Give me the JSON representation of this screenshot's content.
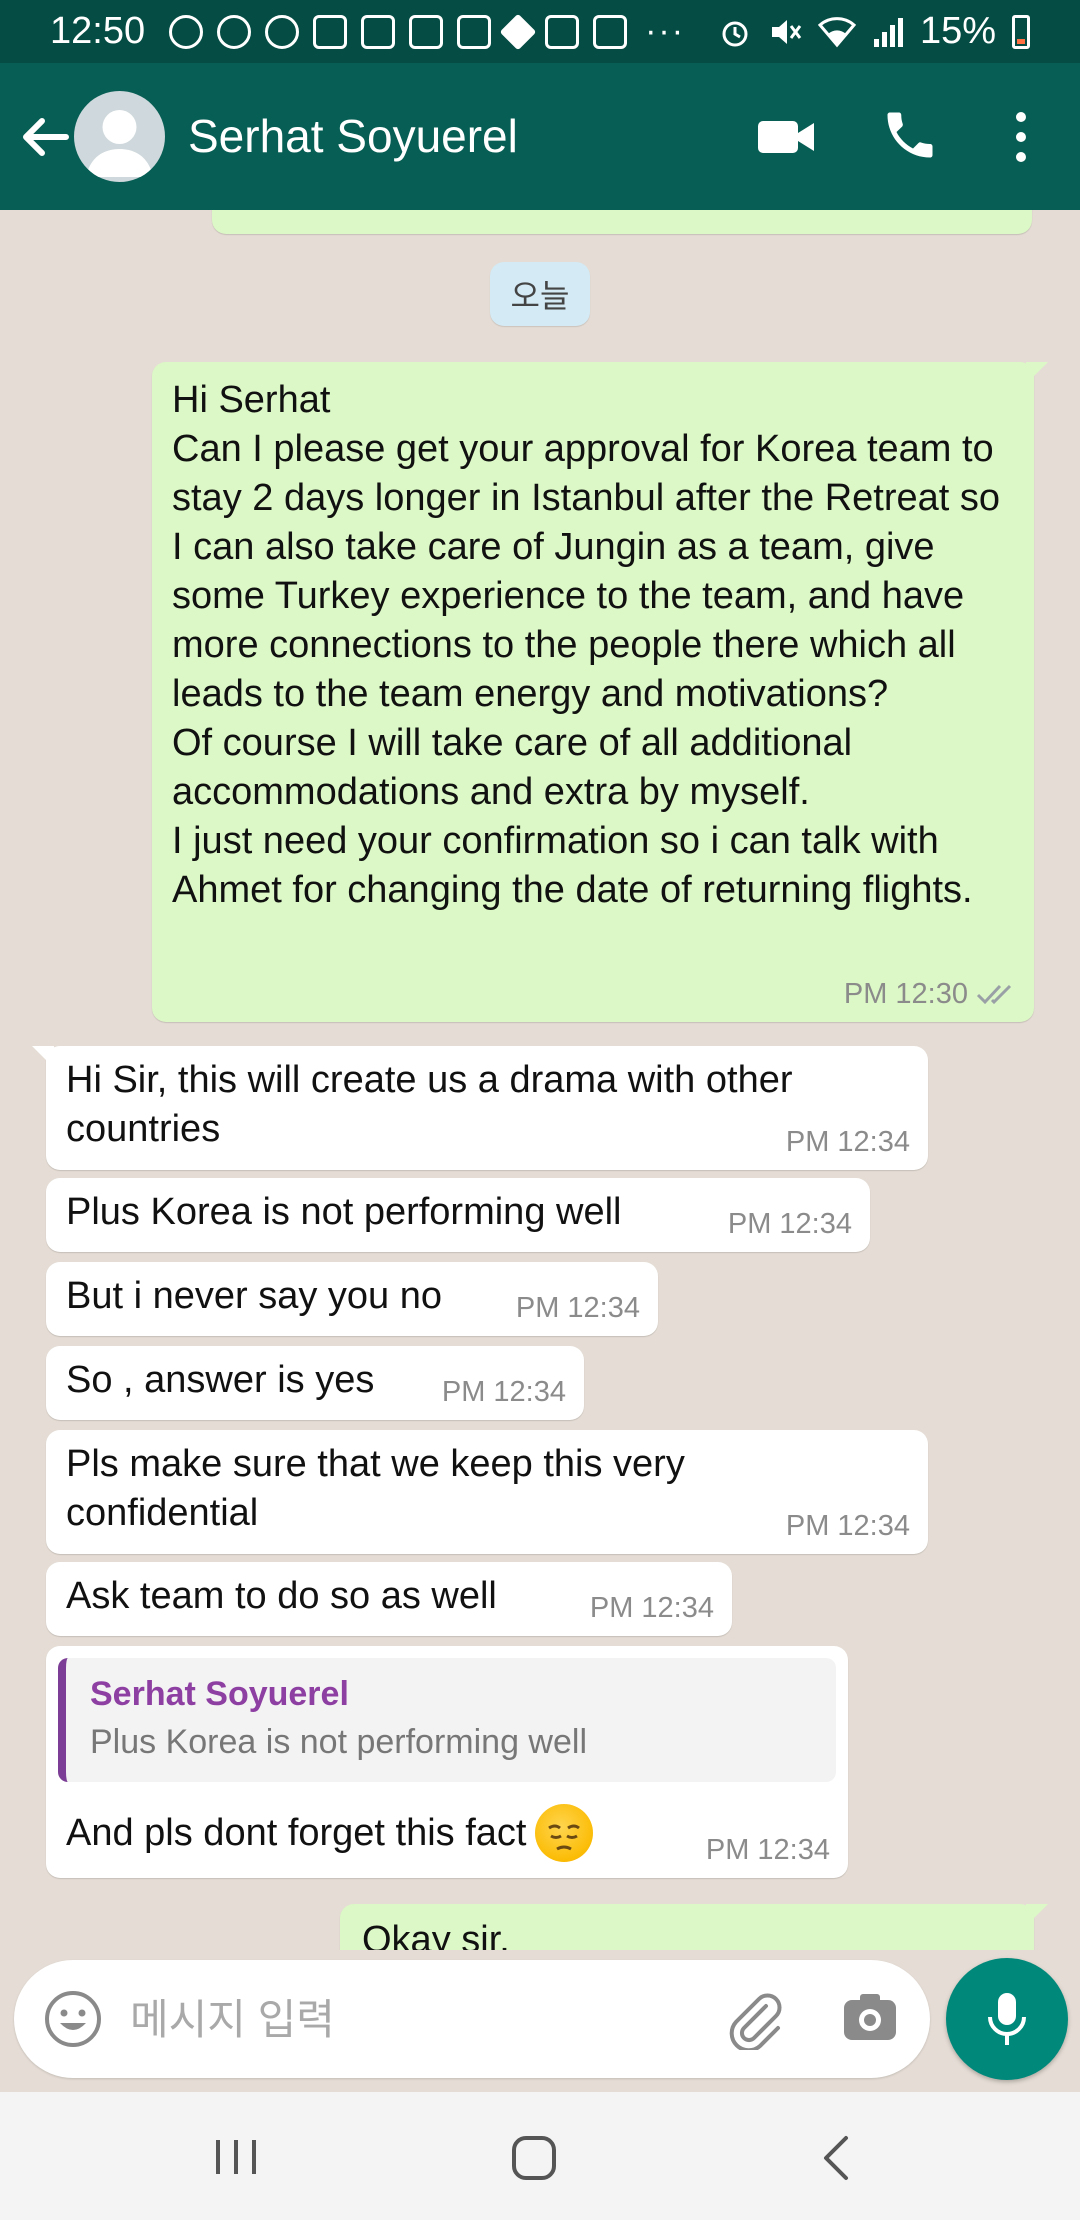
{
  "status_bar": {
    "time": "12:50",
    "overflow_dots": "···",
    "battery_percent": "15%",
    "notification_icons": [
      "circle-app-icon",
      "whatsapp-icon",
      "chat-at-icon",
      "gmail-icon",
      "gmail-icon",
      "jira-icon",
      "gmail-icon",
      "diamond-icon",
      "instagram-icon",
      "gmail-icon"
    ],
    "battery_level": 0.15
  },
  "header": {
    "contact_name": "Serhat Soyuerel",
    "colors": {
      "bar": "#075e54",
      "status": "#054d44"
    }
  },
  "chat": {
    "date_chip": "오늘",
    "messages": [
      {
        "direction": "out",
        "text": "Hi Serhat\nCan I please get your approval for Korea team to stay 2 days longer in Istanbul after the Retreat so I can also take care of Jungin as a team, give some Turkey experience to the team, and have more connections to the people there which all leads to the team energy and motivations?\nOf course I will take care of all additional accommodations and extra by myself.\nI just need your confirmation so i can talk with Ahmet for changing the date of returning flights.",
        "time": "PM 12:30",
        "read": true
      },
      {
        "direction": "in",
        "text": "Hi Sir, this will create us a drama with other countries",
        "time": "PM 12:34"
      },
      {
        "direction": "in",
        "text": "Plus Korea is not performing well",
        "time": "PM 12:34"
      },
      {
        "direction": "in",
        "text": "But i never say you no",
        "time": "PM 12:34"
      },
      {
        "direction": "in",
        "text": "So , answer is yes",
        "time": "PM 12:34"
      },
      {
        "direction": "in",
        "text": "Pls make sure that we keep this very confidential",
        "time": "PM 12:34"
      },
      {
        "direction": "in",
        "text": "Ask team to do so as well",
        "time": "PM 12:34"
      },
      {
        "direction": "in",
        "quote": {
          "author": "Serhat Soyuerel",
          "text": "Plus Korea is not performing well"
        },
        "text": "And pls dont forget this fact",
        "emoji": "pensive-face",
        "time": "PM 12:34"
      },
      {
        "direction": "out",
        "text": "Okay sir.",
        "partial": true
      }
    ],
    "colors": {
      "outgoing": "#dcf8c6",
      "incoming": "#ffffff",
      "background": "#e5ddd5",
      "quote_accent": "#7b3d95"
    }
  },
  "composer": {
    "placeholder": "메시지 입력",
    "colors": {
      "mic_button": "#00897b"
    }
  }
}
